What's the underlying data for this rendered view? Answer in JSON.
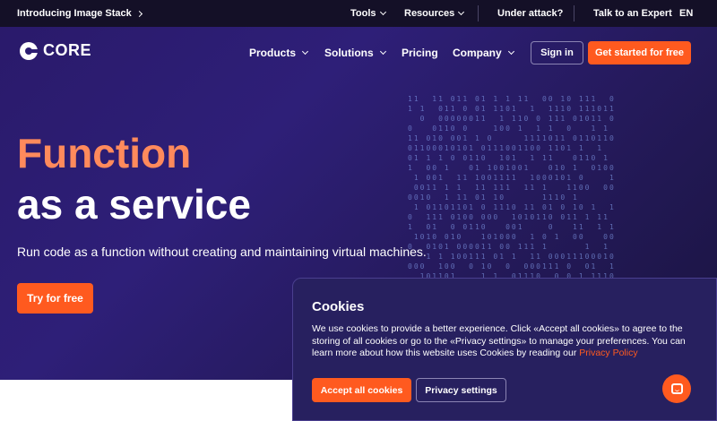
{
  "topbar": {
    "announcement": "Introducing Image Stack",
    "links": [
      "Tools",
      "Resources"
    ],
    "under_attack": "Under attack?",
    "talk_expert": "Talk to an Expert",
    "lang": "EN"
  },
  "nav": {
    "logo_text": "CORE",
    "items": [
      "Products",
      "Solutions",
      "Pricing",
      "Company"
    ],
    "sign_in": "Sign in",
    "get_started": "Get started for free"
  },
  "hero": {
    "title_line1": "Function",
    "title_line2": "as a service",
    "subtitle": "Run code as a function without creating and maintaining virtual machines.",
    "cta": "Try for free"
  },
  "cookies": {
    "title": "Cookies",
    "body_text": "We use cookies to provide a better experience. Click «Accept all cookies» to agree to the storing of all cookies or go to the «Privacy settings» to manage your preferences. You can learn more about how this website uses Cookies by reading our ",
    "policy_link": "Privacy Policy",
    "accept_button": "Accept all cookies",
    "settings_button": "Privacy settings"
  },
  "icons": {
    "announcement_arrow": "chevron-right-icon",
    "dropdown": "chevron-down-icon",
    "logo": "core-logo-icon",
    "chat": "chat-icon"
  },
  "colors": {
    "accent": "#ff5a1f",
    "hero_title_accent": "#ff8a5c",
    "topbar_bg": "#141027",
    "hero_bg": "#2a1a6b"
  }
}
